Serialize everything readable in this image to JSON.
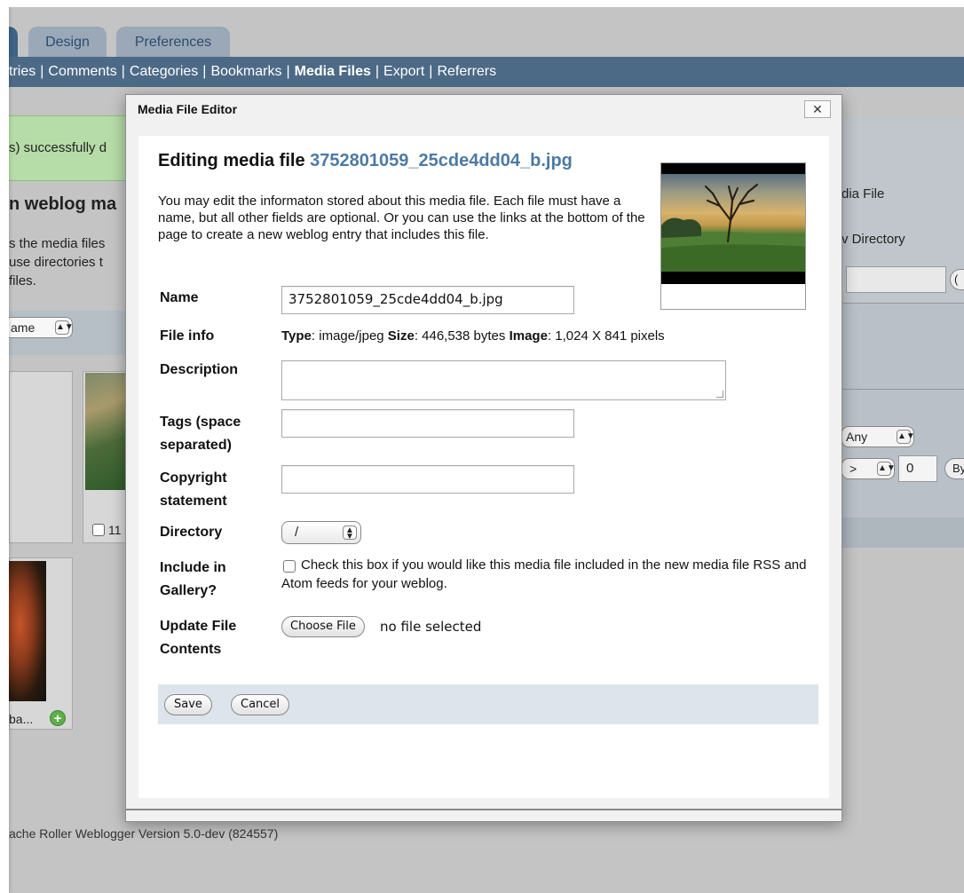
{
  "tabs": {
    "design": "Design",
    "preferences": "Preferences"
  },
  "nav": {
    "items": [
      "tries",
      "Comments",
      "Categories",
      "Bookmarks",
      "Media Files",
      "Export",
      "Referrers"
    ],
    "separator": "|"
  },
  "background": {
    "success_message": "s) successfully d",
    "heading": "n weblog ma",
    "desc_lines": [
      "s the media files",
      " use directories t",
      " files."
    ],
    "sort_value": "ame",
    "card_number": "11",
    "leaf_label": "ba...",
    "footer": "ache Roller Weblogger Version 5.0-dev (824557)",
    "right_panel": {
      "line1": "dia File",
      "line2": "v Directory",
      "btn_partial": "(",
      "any_value": "Any",
      "op_value": ">",
      "number_value": "0",
      "by_partial": "By"
    }
  },
  "modal": {
    "title": "Media File Editor",
    "close_glyph": "✕",
    "heading_prefix": "Editing media file ",
    "heading_filename": "3752801059_25cde4dd04_b.jpg",
    "intro": "You may edit the informaton stored about this media file. Each file must have a name, but all other fields are optional. Or you can use the links at the bottom of the page to create a new weblog entry that includes this file.",
    "labels": {
      "name": "Name",
      "file_info": "File info",
      "description": "Description",
      "tags_line1": "Tags (space",
      "tags_line2": "separated)",
      "copyright_line1": "Copyright",
      "copyright_line2": "statement",
      "directory": "Directory",
      "gallery_line1": "Include in",
      "gallery_line2": "Gallery?",
      "update_line1": "Update File",
      "update_line2": "Contents"
    },
    "name_value": "3752801059_25cde4dd04_b.jpg",
    "file_info": {
      "type_label": "Type",
      "type_value": ": image/jpeg ",
      "size_label": "Size",
      "size_value": ": 446,538 bytes ",
      "image_label": "Image",
      "image_value": ": 1,024 X 841 pixels"
    },
    "description_value": "",
    "tags_value": "",
    "copyright_value": "",
    "directory_value": "/",
    "gallery_checked": false,
    "gallery_text": "Check this box if you would like this media file included in the new media file RSS and Atom feeds for your weblog.",
    "choose_file_label": "Choose File",
    "no_file_text": "no file selected",
    "save_label": "Save",
    "cancel_label": "Cancel"
  }
}
